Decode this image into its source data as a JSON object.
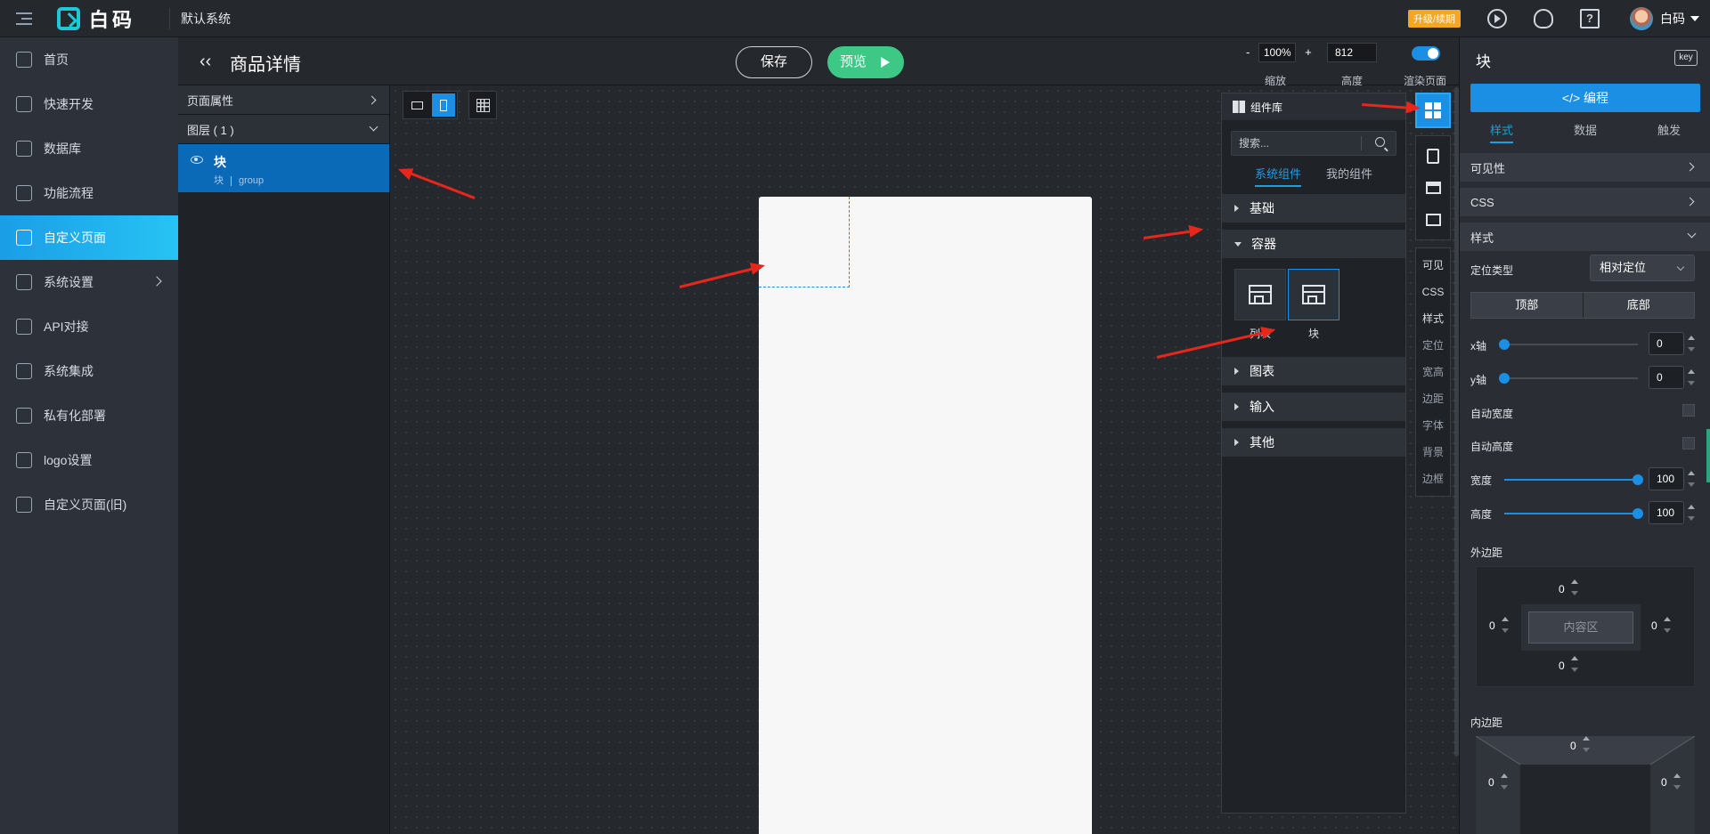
{
  "topbar": {
    "logo_text": "白码",
    "system_name": "默认系统",
    "upgrade_badge": "升级/续期",
    "user_name": "白码",
    "help_glyph": "?"
  },
  "sidebar": {
    "items": [
      {
        "label": "首页",
        "icon": "home-icon"
      },
      {
        "label": "快速开发",
        "icon": "cube-icon"
      },
      {
        "label": "数据库",
        "icon": "database-icon"
      },
      {
        "label": "功能流程",
        "icon": "flow-icon"
      },
      {
        "label": "自定义页面",
        "icon": "monitor-icon",
        "active": true
      },
      {
        "label": "系统设置",
        "icon": "settings-chart-icon",
        "has_arrow": true
      },
      {
        "label": "API对接",
        "icon": "api-gear-icon"
      },
      {
        "label": "系统集成",
        "icon": "layers-icon"
      },
      {
        "label": "私有化部署",
        "icon": "lock-icon"
      },
      {
        "label": "logo设置",
        "icon": "logo-g-icon"
      },
      {
        "label": "自定义页面(旧)",
        "icon": "monitor-old-icon"
      }
    ]
  },
  "pagebar": {
    "back_glyph": "‹‹",
    "title": "商品详情",
    "save_label": "保存",
    "preview_label": "预览",
    "zoom_minus": "-",
    "zoom_value": "100%",
    "zoom_plus": "+",
    "zoom_caption": "缩放",
    "height_value": "812",
    "height_caption": "高度",
    "render_caption": "渲染页面",
    "render_enabled": true
  },
  "layers": {
    "page_props_label": "页面属性",
    "layer_header": "图层 ( 1 )",
    "items": [
      {
        "name": "块",
        "type": "块",
        "code": "group",
        "selected": true
      }
    ]
  },
  "canvas": {
    "device_mode": "mobile",
    "grid_enabled": true
  },
  "component_library": {
    "title": "组件库",
    "search_placeholder": "搜索...",
    "tabs": [
      {
        "label": "系统组件",
        "active": true
      },
      {
        "label": "我的组件",
        "active": false
      }
    ],
    "categories": [
      {
        "label": "基础",
        "expanded": false
      },
      {
        "label": "容器",
        "expanded": true,
        "items": [
          {
            "label": "列表",
            "icon": "list-layout-icon",
            "active": false
          },
          {
            "label": "块",
            "icon": "block-layout-icon",
            "active": true
          }
        ]
      },
      {
        "label": "图表",
        "expanded": false
      },
      {
        "label": "输入",
        "expanded": false
      },
      {
        "label": "其他",
        "expanded": false
      }
    ]
  },
  "side_strip": {
    "icons": [
      "components-grid-icon",
      "clipboard-icon",
      "table-layout-icon",
      "image-icon"
    ],
    "shortcuts": [
      {
        "label": "可见",
        "bold": true
      },
      {
        "label": "CSS",
        "bold": true
      },
      {
        "label": "样式",
        "bold": true
      },
      {
        "label": "定位",
        "bold": false
      },
      {
        "label": "宽高",
        "bold": false
      },
      {
        "label": "边距",
        "bold": false
      },
      {
        "label": "字体",
        "bold": false
      },
      {
        "label": "背景",
        "bold": false
      },
      {
        "label": "边框",
        "bold": false
      }
    ]
  },
  "props": {
    "title": "块",
    "key_badge": "key",
    "code_button": "</>  编程",
    "tabs": [
      {
        "label": "样式",
        "active": true
      },
      {
        "label": "数据",
        "active": false
      },
      {
        "label": "触发",
        "active": false
      }
    ],
    "sections": {
      "visibility": "可见性",
      "css": "CSS",
      "style": "样式"
    },
    "position_type_label": "定位类型",
    "position_type_value": "相对定位",
    "anchor_top": "顶部",
    "anchor_bottom": "底部",
    "x_label": "x轴",
    "x_value": "0",
    "x_level": 0,
    "y_label": "y轴",
    "y_value": "0",
    "y_level": 0,
    "auto_width_label": "自动宽度",
    "auto_height_label": "自动高度",
    "width_label": "宽度",
    "width_value": "100",
    "width_level": 1.0,
    "height_label": "高度",
    "height_value": "100",
    "height_level": 1.0,
    "margin_label": "外边距",
    "margin": {
      "top": "0",
      "left": "0",
      "right": "0",
      "bottom": "0"
    },
    "content_area": "内容区",
    "padding_label": "内边距",
    "padding": {
      "top": "0",
      "left": "0",
      "right": "0"
    }
  },
  "colors": {
    "accent": "#1a8fe3",
    "preview_green": "#3ec886",
    "annotation_red": "#e8261c",
    "upgrade_orange": "#f6a623"
  }
}
